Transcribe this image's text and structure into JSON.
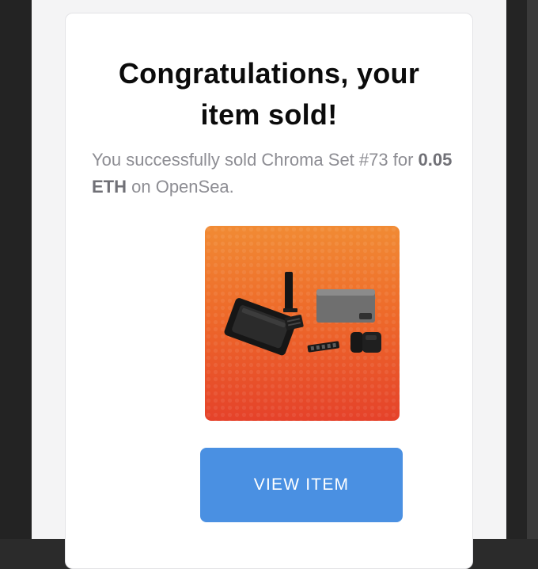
{
  "email": {
    "title_line1": "Congratulations, your",
    "title_line2": "item sold!",
    "message_prefix": "You successfully sold Chroma Set #73 for",
    "message_amount": "0.05 ETH",
    "message_suffix": "on OpenSea.",
    "button_label": "VIEW ITEM"
  },
  "colors": {
    "button": "#4a90e2",
    "image_gradient_top": "#f18b34",
    "image_gradient_bottom": "#e5422a"
  }
}
